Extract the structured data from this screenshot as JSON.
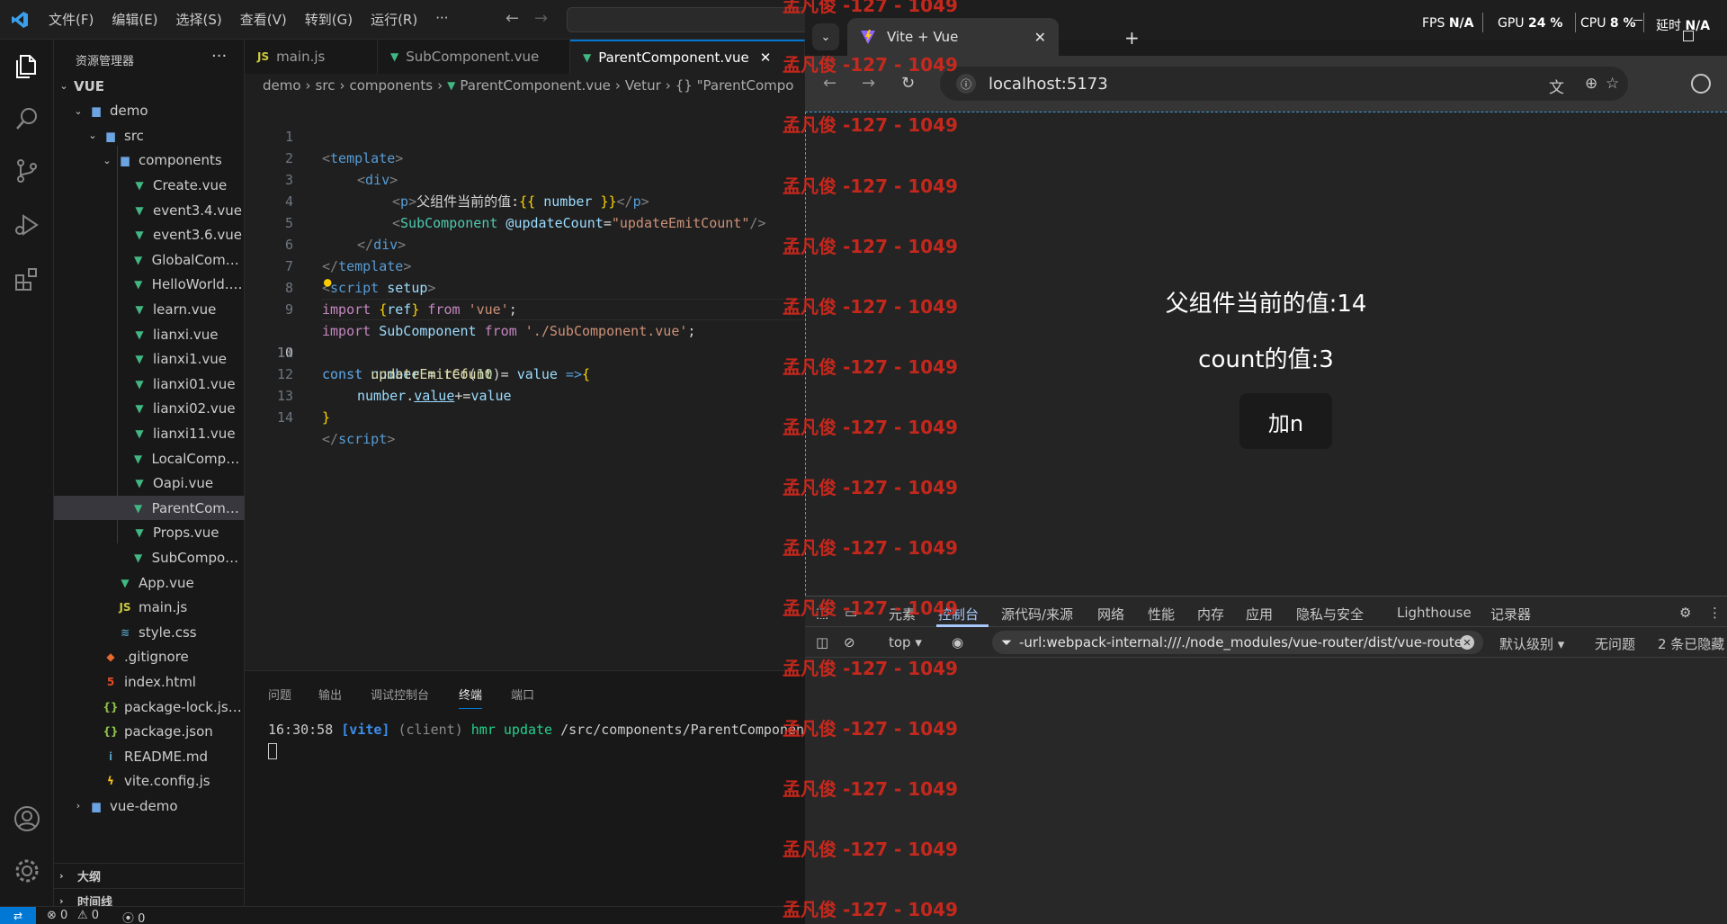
{
  "vscode": {
    "menu": [
      "文件(F)",
      "编辑(E)",
      "选择(S)",
      "查看(V)",
      "转到(G)",
      "运行(R)",
      "···"
    ],
    "explorer_title": "资源管理器",
    "tree": [
      {
        "label": "VUE",
        "kind": "root"
      },
      {
        "label": "demo",
        "kind": "folder"
      },
      {
        "label": "src",
        "kind": "folder"
      },
      {
        "label": "components",
        "kind": "folder"
      },
      {
        "label": "Create.vue",
        "kind": "vue"
      },
      {
        "label": "event3.4.vue",
        "kind": "vue"
      },
      {
        "label": "event3.6.vue",
        "kind": "vue"
      },
      {
        "label": "GlobalCompo...",
        "kind": "vue"
      },
      {
        "label": "HelloWorld.vue",
        "kind": "vue"
      },
      {
        "label": "learn.vue",
        "kind": "vue"
      },
      {
        "label": "lianxi.vue",
        "kind": "vue"
      },
      {
        "label": "lianxi1.vue",
        "kind": "vue"
      },
      {
        "label": "lianxi01.vue",
        "kind": "vue"
      },
      {
        "label": "lianxi02.vue",
        "kind": "vue"
      },
      {
        "label": "lianxi11.vue",
        "kind": "vue"
      },
      {
        "label": "LocalCompon...",
        "kind": "vue"
      },
      {
        "label": "Oapi.vue",
        "kind": "vue"
      },
      {
        "label": "ParentCompo...",
        "kind": "vue"
      },
      {
        "label": "Props.vue",
        "kind": "vue"
      },
      {
        "label": "SubCompone...",
        "kind": "vue"
      },
      {
        "label": "App.vue",
        "kind": "vue"
      },
      {
        "label": "main.js",
        "kind": "js"
      },
      {
        "label": "style.css",
        "kind": "css"
      },
      {
        "label": ".gitignore",
        "kind": "git"
      },
      {
        "label": "index.html",
        "kind": "html"
      },
      {
        "label": "package-lock.json",
        "kind": "json"
      },
      {
        "label": "package.json",
        "kind": "json"
      },
      {
        "label": "README.md",
        "kind": "info"
      },
      {
        "label": "vite.config.js",
        "kind": "vite"
      },
      {
        "label": "vue-demo",
        "kind": "folder"
      }
    ],
    "sections": [
      "大纲",
      "时间线"
    ],
    "tabs": [
      "main.js",
      "SubComponent.vue",
      "ParentComponent.vue"
    ],
    "breadcrumb": [
      "demo",
      "src",
      "components",
      "ParentComponent.vue",
      "Vetur",
      "{} \"ParentCompo"
    ],
    "line_numbers": [
      "1",
      "2",
      "3",
      "4",
      "5",
      "6",
      "7",
      "8",
      "9",
      "10",
      "11",
      "12",
      "13",
      "14"
    ],
    "code": {
      "l1": {
        "a": "<",
        "b": "template",
        "c": ">"
      },
      "l2": {
        "a": "<",
        "b": "div",
        "c": ">"
      },
      "l3": {
        "a": "<",
        "b": "p",
        "c": ">",
        "d": "父组件当前的值:",
        "e": "{{",
        "f": " number ",
        "g": "}}",
        "h": "</",
        "i": "p",
        "j": ">"
      },
      "l4": {
        "a": "<",
        "b": "SubComponent",
        "c": " @updateCount",
        "d": "=",
        "e": "\"updateEmitCount\"",
        "f": "/>"
      },
      "l5": {
        "a": "</",
        "b": "div",
        "c": ">"
      },
      "l6": {
        "a": "</",
        "b": "template",
        "c": ">"
      },
      "l7": {
        "a": "<",
        "b": "script",
        "c": " setup",
        "d": ">"
      },
      "l8": {
        "a": "import ",
        "b": "{",
        "c": "ref",
        "d": "}",
        "e": " from ",
        "f": "'vue'",
        "g": ";"
      },
      "l9": {
        "a": "import ",
        "b": "SubComponent",
        "c": " from ",
        "d": "'./SubComponent.vue'",
        "e": ";"
      },
      "l10": {
        "a": "const ",
        "b": "number",
        "c": " = ",
        "d": "ref",
        "e": "(",
        "f": "10",
        "g": ")"
      },
      "l11": {
        "a": "const ",
        "b": "updateEmitCount",
        "c": " = ",
        "d": "value",
        "e": " =>",
        "f": "{"
      },
      "l12": {
        "a": "number",
        "b": ".",
        "c": "value",
        "d": "+=",
        "e": "value"
      },
      "l13": {
        "a": "}"
      },
      "l14": {
        "a": "</",
        "b": "script",
        "c": ">"
      }
    },
    "panel_tabs": [
      "问题",
      "输出",
      "调试控制台",
      "终端",
      "端口"
    ],
    "terminal": {
      "time": "16:30:58 ",
      "tag": "[vite]",
      "client": " (client) ",
      "hmr": "hmr update ",
      "path": "/src/components/ParentComponen"
    },
    "status": {
      "errors": "0",
      "warnings": "0",
      "ports": "0"
    }
  },
  "browser": {
    "tab_title": "Vite + Vue",
    "url": "localhost:5173",
    "perf": {
      "fps_label": "FPS",
      "fps": "N/A",
      "gpu_label": "GPU",
      "gpu": "24 %",
      "cpu_label": "CPU",
      "cpu": "8 %",
      "lat_label": "延时",
      "lat": "N/A"
    },
    "page": {
      "parent_value": "父组件当前的值:14",
      "count_value": "count的值:3",
      "button": "加n"
    },
    "devtools": {
      "tabs": [
        "元素",
        "控制台",
        "源代码/来源",
        "网络",
        "性能",
        "内存",
        "应用",
        "隐私与安全",
        "Lighthouse",
        "记录器"
      ],
      "context": "top",
      "filter": "-url:webpack-internal:///./node_modules/vue-router/dist/vue-route",
      "level": "默认级别",
      "issues": "无问题",
      "hidden": "2 条已隐藏"
    }
  },
  "watermark": "孟凡俊 -127 - 1049",
  "colors": {
    "accent": "#0078d4",
    "vue_green": "#41b883",
    "watermark_red": "#d6281c"
  }
}
